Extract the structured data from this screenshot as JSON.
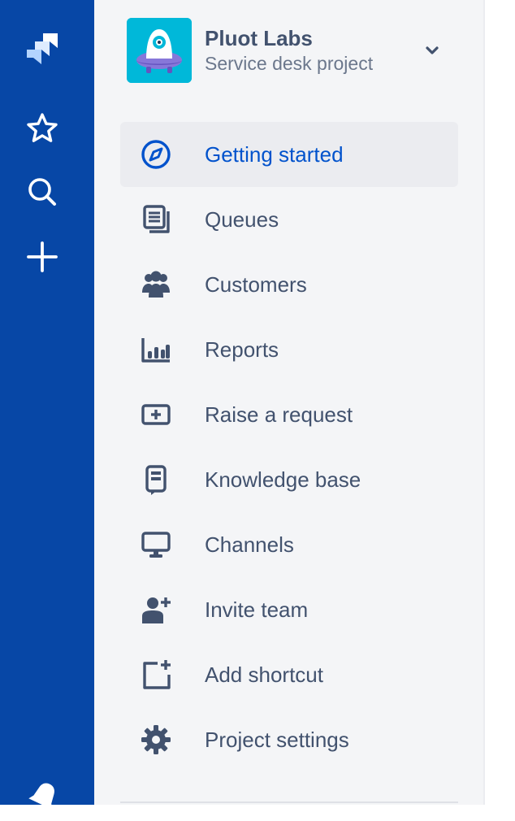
{
  "global_nav": {
    "items": [
      {
        "name": "jira-logo-icon",
        "icon": "jira-logo"
      },
      {
        "name": "starred-icon",
        "icon": "star"
      },
      {
        "name": "search-icon",
        "icon": "search"
      },
      {
        "name": "create-icon",
        "icon": "plus"
      },
      {
        "name": "notifications-icon",
        "icon": "bell"
      }
    ]
  },
  "project": {
    "name": "Pluot Labs",
    "type": "Service desk project",
    "avatar_icon": "ufo-avatar",
    "switcher_icon": "chevron-down"
  },
  "nav": {
    "items": [
      {
        "label": "Getting started",
        "icon": "compass",
        "selected": true
      },
      {
        "label": "Queues",
        "icon": "queues",
        "selected": false
      },
      {
        "label": "Customers",
        "icon": "people",
        "selected": false
      },
      {
        "label": "Reports",
        "icon": "graph-bar",
        "selected": false
      },
      {
        "label": "Raise a request",
        "icon": "screen-plus",
        "selected": false
      },
      {
        "label": "Knowledge base",
        "icon": "book",
        "selected": false
      },
      {
        "label": "Channels",
        "icon": "monitor",
        "selected": false
      },
      {
        "label": "Invite team",
        "icon": "person-add",
        "selected": false
      },
      {
        "label": "Add shortcut",
        "icon": "shortcut-add",
        "selected": false
      },
      {
        "label": "Project settings",
        "icon": "gear",
        "selected": false
      }
    ]
  },
  "colors": {
    "global_nav_bg": "#0747a6",
    "sidebar_bg": "#f4f5f7",
    "selected_item_bg": "#ebecf0",
    "selected_text": "#0052cc",
    "text": "#42526e",
    "subtext": "#6b778c",
    "avatar_bg": "#00b8d9"
  }
}
